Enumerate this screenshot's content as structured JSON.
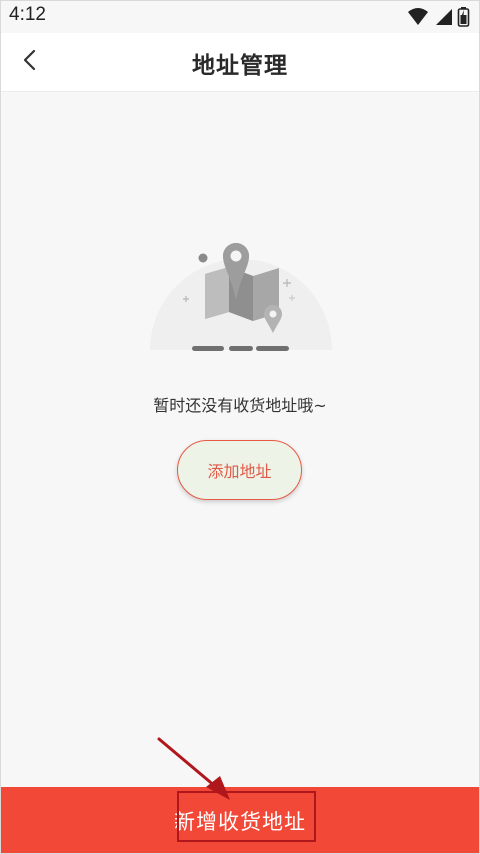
{
  "status_bar": {
    "time": "4:12",
    "icons": [
      "wifi-icon",
      "signal-icon",
      "battery-icon"
    ]
  },
  "header": {
    "back_icon": "chevron-left-icon",
    "title": "地址管理"
  },
  "empty_state": {
    "illustration": "map-location-illustration",
    "message": "暂时还没有收货地址哦~",
    "add_button_label": "添加地址"
  },
  "bottom_bar": {
    "label": "新增收货地址"
  },
  "colors": {
    "accent": "#f24837",
    "button_border": "#e85a45",
    "button_fill": "#eef3e7",
    "annotation": "#b0171c"
  }
}
